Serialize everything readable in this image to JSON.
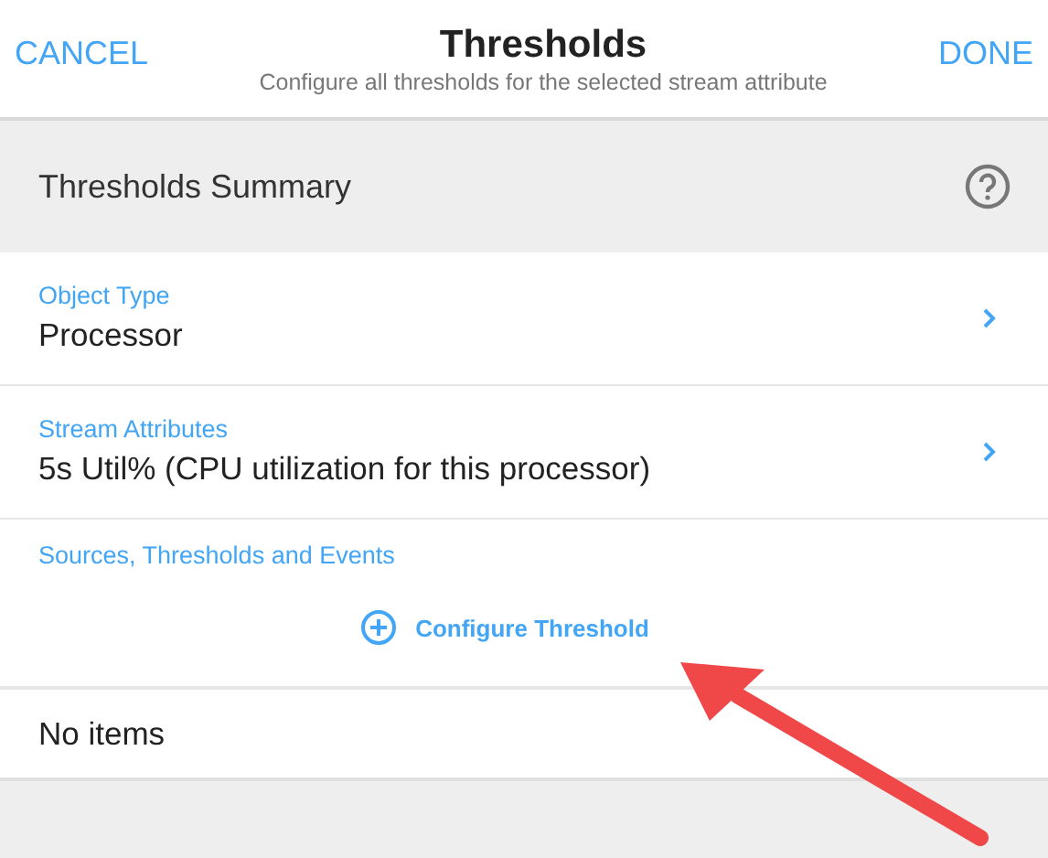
{
  "header": {
    "cancel": "CANCEL",
    "title": "Thresholds",
    "subtitle": "Configure all thresholds for the selected stream attribute",
    "done": "DONE"
  },
  "summary": {
    "title": "Thresholds Summary"
  },
  "fields": [
    {
      "label": "Object Type",
      "value": "Processor"
    },
    {
      "label": "Stream Attributes",
      "value": "5s Util% (CPU utilization for this processor)"
    }
  ],
  "sources": {
    "label": "Sources, Thresholds and Events",
    "action": "Configure Threshold",
    "empty": "No items"
  }
}
